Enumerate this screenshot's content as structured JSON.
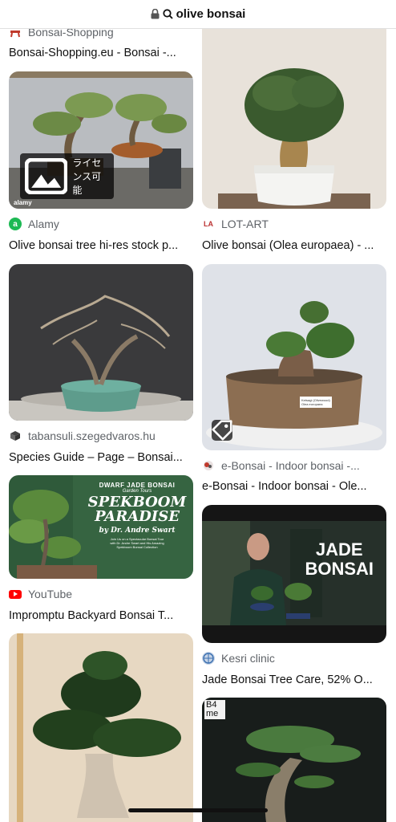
{
  "browser": {
    "search_query": "olive bonsai"
  },
  "results": {
    "top_partial": {
      "source": "Bonsai-Shopping",
      "title": "Bonsai-Shopping.eu - Bonsai -..."
    },
    "r1": {
      "source": "Alamy",
      "title": "Olive bonsai tree hi-res stock p...",
      "badge": "ライセンス可能",
      "watermark": "alamy"
    },
    "r2": {
      "source": "LOT-ART",
      "title": "Olive bonsai (Olea europaea) - ..."
    },
    "r3": {
      "source": "tabansuli.szegedvaros.hu",
      "title": "Species Guide – Page – Bonsai..."
    },
    "r4": {
      "source": "e-Bonsai - Indoor bonsai -...",
      "title": "e-Bonsai - Indoor bonsai - Ole...",
      "pot_label_1": "Ketsagi (Olivewood)",
      "pot_label_2": "Olea europaea"
    },
    "r5": {
      "source": "YouTube",
      "title": "Impromptu Backyard Bonsai T...",
      "thumb_line1": "DWARF JADE BONSAI",
      "thumb_line2": "Garden Tours",
      "thumb_big1": "SPEKBOOM",
      "thumb_big2": "PARADISE",
      "thumb_by": "by Dr. Andre Swart",
      "thumb_desc1": "Join Us on a Spectacular Bonsai Tour",
      "thumb_desc2": "with Dr. Andre Swart and His Amazing",
      "thumb_desc3": "Spekboom Bonsai Collection"
    },
    "r6": {
      "source": "Kesri clinic",
      "title": "Jade Bonsai Tree Care, 52% O...",
      "thumb_big1": "JADE",
      "thumb_big2": "BONSAI"
    },
    "r8": {
      "logo_line1": "B4",
      "logo_line2": "me"
    }
  },
  "colors": {
    "alamy_green": "#1db954",
    "youtube_red": "#ff0000"
  },
  "icons": [
    "lock-icon",
    "search-icon",
    "image-icon",
    "tag-icon"
  ]
}
